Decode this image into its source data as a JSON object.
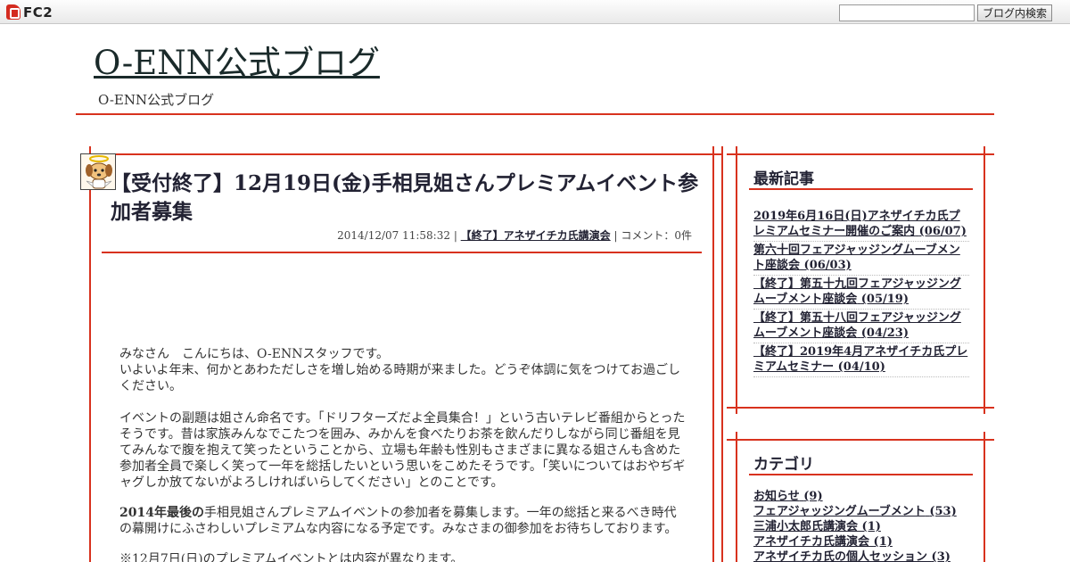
{
  "fc2bar": {
    "logo_text": "FC2",
    "search_placeholder": "",
    "search_button": "ブログ内検索"
  },
  "blog": {
    "title": "O-ENN公式ブログ",
    "subtitle": "O-ENN公式ブログ"
  },
  "entry": {
    "title": "【受付終了】12月19日(金)手相見姐さんプレミアムイベント参加者募集",
    "date": "2014/12/07 11:58:32",
    "sep1": " | ",
    "category": "【終了】アネザイチカ氏講演会",
    "sep2": " | ",
    "comment": "コメント：0件",
    "body": {
      "p1_line1": "みなさん　こんにちは、O-ENNスタッフです。",
      "p1_line2": "いよいよ年末、何かとあわただしさを増し始める時期が来ました。どうぞ体調に気をつけてお過ごしください。",
      "p2": "イベントの副題は姐さん命名です。「ドリフターズだよ全員集合！」という古いテレビ番組からとったそうです。昔は家族みんなでこたつを囲み、みかんを食べたりお茶を飲んだりしながら同じ番組を見てみんなで腹を抱えて笑ったということから、立場も年齢も性別もさまざまに異なる姐さんも含めた参加者全員で楽しく笑って一年を総括したいという思いをこめたそうです。「笑いについてはおやぢギャグしか放てないがよろしければいらしてください」とのことです。",
      "p3_bold": "2014年最後の",
      "p3_rest": "手相見姐さんプレミアムイベントの参加者を募集します。一年の総括と来るべき時代の幕開けにふさわしいプレミアムな内容になる予定です。みなさまの御参加をお待ちしております。",
      "p4": "※12月7日(日)のプレミアムイベントとは内容が異なります。"
    }
  },
  "sidebar": {
    "recent_heading": "最新記事",
    "recent": [
      {
        "title": "2019年6月16日(日)アネザイチカ氏プレミアムセミナー開催のご案内",
        "date": "(06/07)"
      },
      {
        "title": "第六十回フェアジャッジングムーブメント座談会",
        "date": "(06/03)"
      },
      {
        "title": "【終了】第五十九回フェアジャッジングムーブメント座談会",
        "date": "(05/19)"
      },
      {
        "title": "【終了】第五十八回フェアジャッジングムーブメント座談会",
        "date": "(04/23)"
      },
      {
        "title": "【終了】2019年4月アネザイチカ氏プレミアムセミナー",
        "date": "(04/10)"
      }
    ],
    "category_heading": "カテゴリ",
    "categories": [
      {
        "name": "お知らせ",
        "count": "(9)"
      },
      {
        "name": "フェアジャッジングムーブメント",
        "count": "(53)"
      },
      {
        "name": "三浦小太郎氏講演会",
        "count": "(1)"
      },
      {
        "name": "アネザイチカ氏講演会",
        "count": "(1)"
      },
      {
        "name": "アネザイチカ氏の個人セッション",
        "count": "(3)"
      }
    ]
  },
  "colors": {
    "accent": "#d8321e",
    "text": "#333333",
    "heading": "#222233"
  },
  "icons": {
    "fc2_logo": "fc2-logo-icon",
    "avatar": "angel-dog-avatar"
  }
}
